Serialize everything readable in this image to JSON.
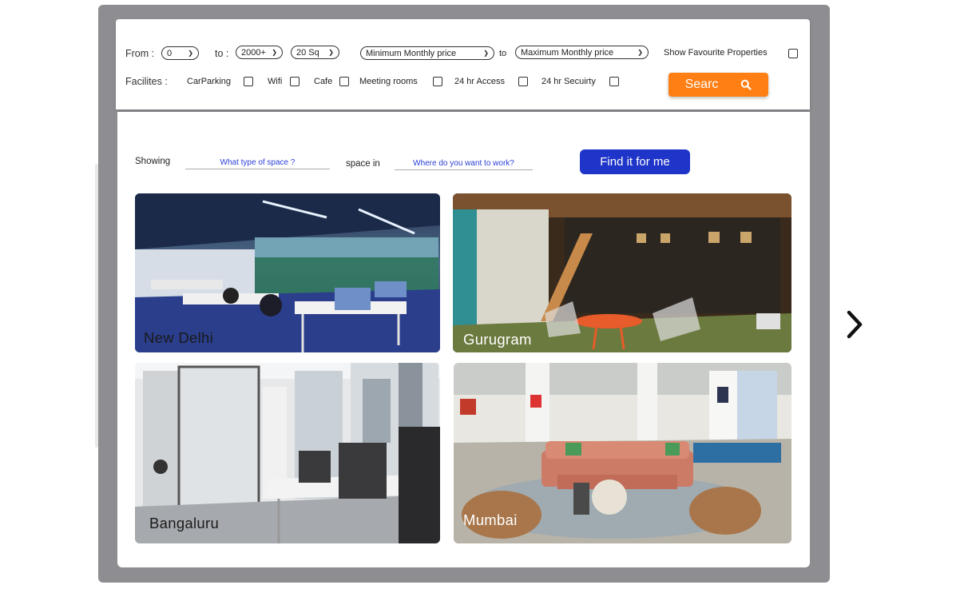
{
  "filters": {
    "from_label": "From :",
    "from_value": "0",
    "to_label": "to :",
    "to_value": "2000+",
    "unit_value": "20 Sq",
    "min_price": "Minimum Monthly price",
    "price_to_label": "to",
    "max_price": "Maximum Monthly price",
    "show_favourites": "Show Favourite Properties",
    "facilities_label": "Facilites :",
    "facilities": [
      {
        "label": "CarParking"
      },
      {
        "label": "Wifi"
      },
      {
        "label": "Cafe"
      },
      {
        "label": "Meeting rooms"
      },
      {
        "label": "24 hr Access"
      },
      {
        "label": "24 hr Secuirty"
      }
    ],
    "search_label": "Searc",
    "search_icon": "search-icon"
  },
  "finder": {
    "showing_label": "Showing",
    "space_type_placeholder": "What type of space ?",
    "space_in_label": "space in",
    "location_placeholder": "Where do you want to work?",
    "find_button": "Find it for me"
  },
  "cities": [
    {
      "name": "New Delhi"
    },
    {
      "name": "Gurugram"
    },
    {
      "name": "Bangaluru"
    },
    {
      "name": "Mumbai"
    }
  ],
  "nav": {
    "next_icon": "chevron-right-icon"
  },
  "colors": {
    "accent_orange": "#ff7f15",
    "primary_blue": "#1f35c9",
    "frame_gray": "#8e8d91"
  }
}
